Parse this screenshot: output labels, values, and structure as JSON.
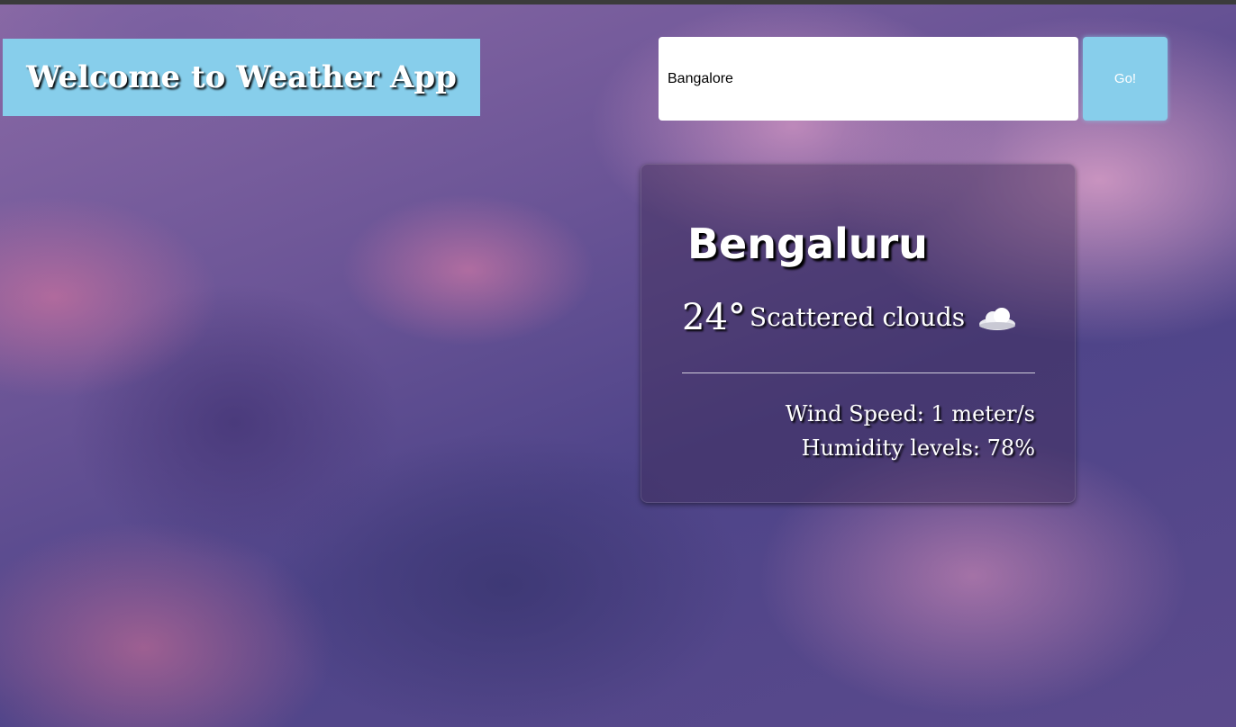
{
  "header": {
    "title": "Welcome to Weather App"
  },
  "search": {
    "value": "Bangalore",
    "button_label": "Go!"
  },
  "weather": {
    "city": "Bengaluru",
    "temperature": "24°",
    "description": "Scattered clouds",
    "icon": "cloud-icon",
    "wind_speed": "Wind Speed: 1 meter/s",
    "humidity": "Humidity levels: 78%"
  },
  "colors": {
    "accent": "#87ceeb",
    "text": "#ffffff"
  }
}
